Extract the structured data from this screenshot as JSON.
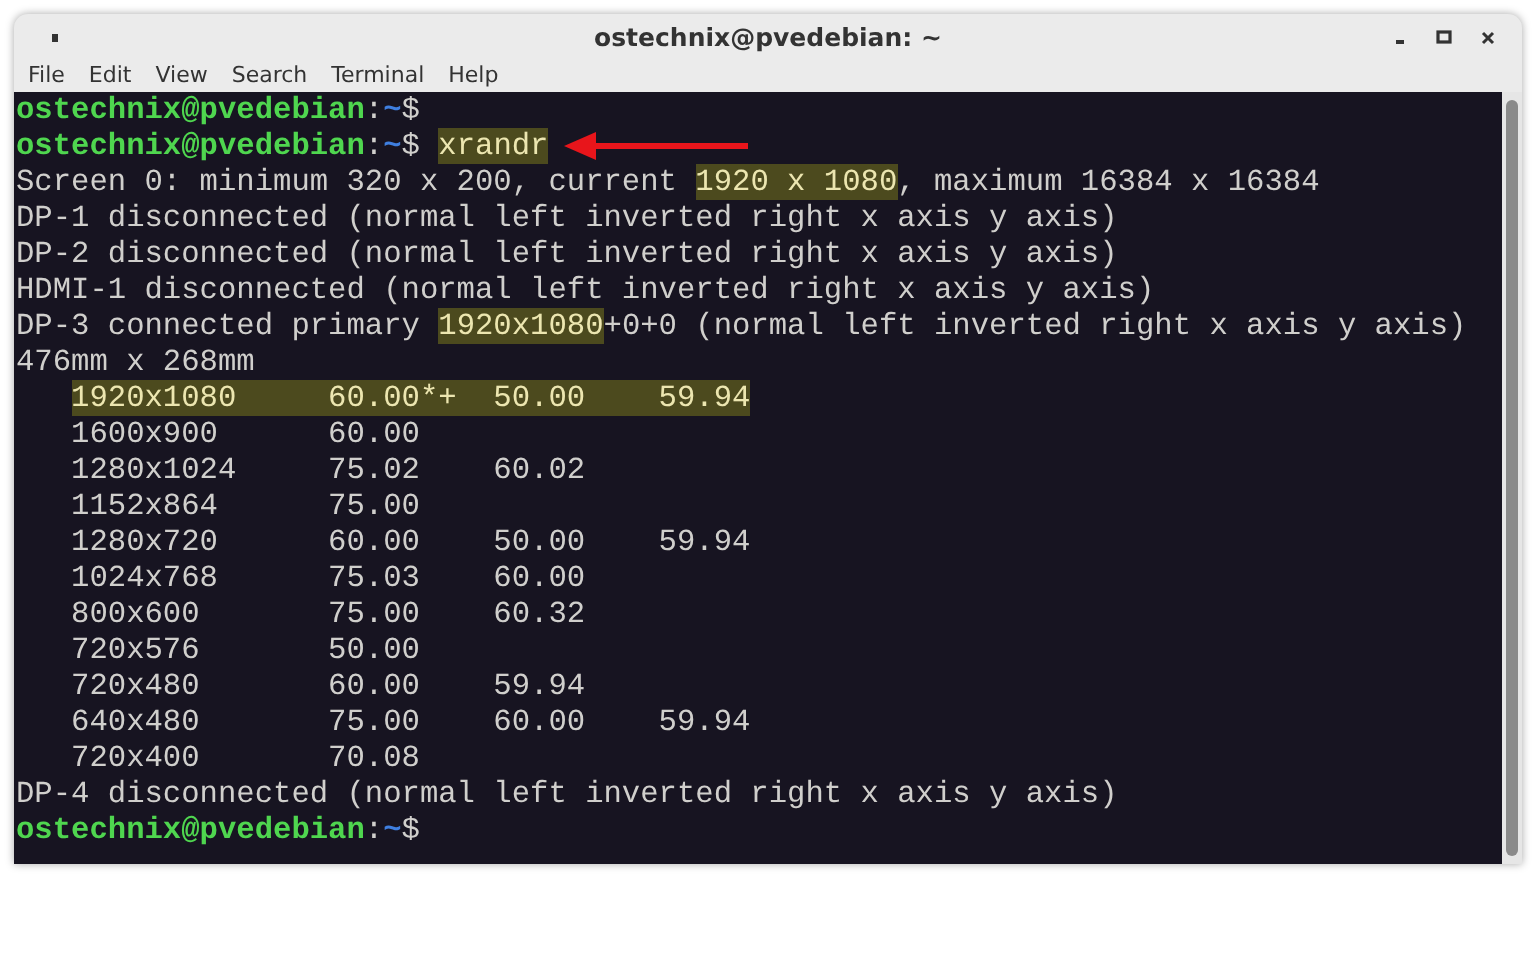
{
  "window": {
    "title": "ostechnix@pvedebian: ~"
  },
  "menu": [
    {
      "label": "File"
    },
    {
      "label": "Edit"
    },
    {
      "label": "View"
    },
    {
      "label": "Search"
    },
    {
      "label": "Terminal"
    },
    {
      "label": "Help"
    }
  ],
  "terminal": {
    "lines": [
      {
        "indented": false,
        "segments": [
          {
            "kind": "user",
            "text": "ostechnix@pvedebian"
          },
          {
            "kind": "plain",
            "text": ":"
          },
          {
            "kind": "path",
            "text": "~"
          },
          {
            "kind": "plain",
            "text": "$"
          }
        ]
      },
      {
        "indented": false,
        "segments": [
          {
            "kind": "user",
            "text": "ostechnix@pvedebian"
          },
          {
            "kind": "plain",
            "text": ":"
          },
          {
            "kind": "path",
            "text": "~"
          },
          {
            "kind": "plain",
            "text": "$ "
          },
          {
            "kind": "highlight",
            "text": "xrandr"
          },
          {
            "kind": "arrow"
          }
        ]
      },
      {
        "indented": false,
        "segments": [
          {
            "kind": "plain",
            "text": "Screen 0: minimum 320 x 200, current "
          },
          {
            "kind": "highlight",
            "text": "1920 x 1080"
          },
          {
            "kind": "plain",
            "text": ", maximum 16384 x 16384"
          }
        ]
      },
      {
        "indented": false,
        "segments": [
          {
            "kind": "plain",
            "text": "DP-1 disconnected (normal left inverted right x axis y axis)"
          }
        ]
      },
      {
        "indented": false,
        "segments": [
          {
            "kind": "plain",
            "text": "DP-2 disconnected (normal left inverted right x axis y axis)"
          }
        ]
      },
      {
        "indented": false,
        "segments": [
          {
            "kind": "plain",
            "text": "HDMI-1 disconnected (normal left inverted right x axis y axis)"
          }
        ]
      },
      {
        "indented": false,
        "segments": [
          {
            "kind": "plain",
            "text": "DP-3 connected primary "
          },
          {
            "kind": "highlight",
            "text": "1920x1080"
          },
          {
            "kind": "plain",
            "text": "+0+0 (normal left inverted right x axis y axis)"
          }
        ]
      },
      {
        "indented": false,
        "segments": [
          {
            "kind": "plain",
            "text": "476mm x 268mm"
          }
        ]
      },
      {
        "indented": true,
        "segments": [
          {
            "kind": "highlight",
            "text": "1920x1080     60.00*+  50.00    59.94"
          }
        ]
      },
      {
        "indented": true,
        "segments": [
          {
            "kind": "plain",
            "text": "1600x900      60.00"
          }
        ]
      },
      {
        "indented": true,
        "segments": [
          {
            "kind": "plain",
            "text": "1280x1024     75.02    60.02"
          }
        ]
      },
      {
        "indented": true,
        "segments": [
          {
            "kind": "plain",
            "text": "1152x864      75.00"
          }
        ]
      },
      {
        "indented": true,
        "segments": [
          {
            "kind": "plain",
            "text": "1280x720      60.00    50.00    59.94"
          }
        ]
      },
      {
        "indented": true,
        "segments": [
          {
            "kind": "plain",
            "text": "1024x768      75.03    60.00"
          }
        ]
      },
      {
        "indented": true,
        "segments": [
          {
            "kind": "plain",
            "text": "800x600       75.00    60.32"
          }
        ]
      },
      {
        "indented": true,
        "segments": [
          {
            "kind": "plain",
            "text": "720x576       50.00"
          }
        ]
      },
      {
        "indented": true,
        "segments": [
          {
            "kind": "plain",
            "text": "720x480       60.00    59.94"
          }
        ]
      },
      {
        "indented": true,
        "segments": [
          {
            "kind": "plain",
            "text": "640x480       75.00    60.00    59.94"
          }
        ]
      },
      {
        "indented": true,
        "segments": [
          {
            "kind": "plain",
            "text": "720x400       70.08"
          }
        ]
      },
      {
        "indented": false,
        "segments": [
          {
            "kind": "plain",
            "text": "DP-4 disconnected (normal left inverted right x axis y axis)"
          }
        ]
      },
      {
        "indented": false,
        "segments": [
          {
            "kind": "user",
            "text": "ostechnix@pvedebian"
          },
          {
            "kind": "plain",
            "text": ":"
          },
          {
            "kind": "path",
            "text": "~"
          },
          {
            "kind": "plain",
            "text": "$"
          }
        ]
      }
    ]
  }
}
